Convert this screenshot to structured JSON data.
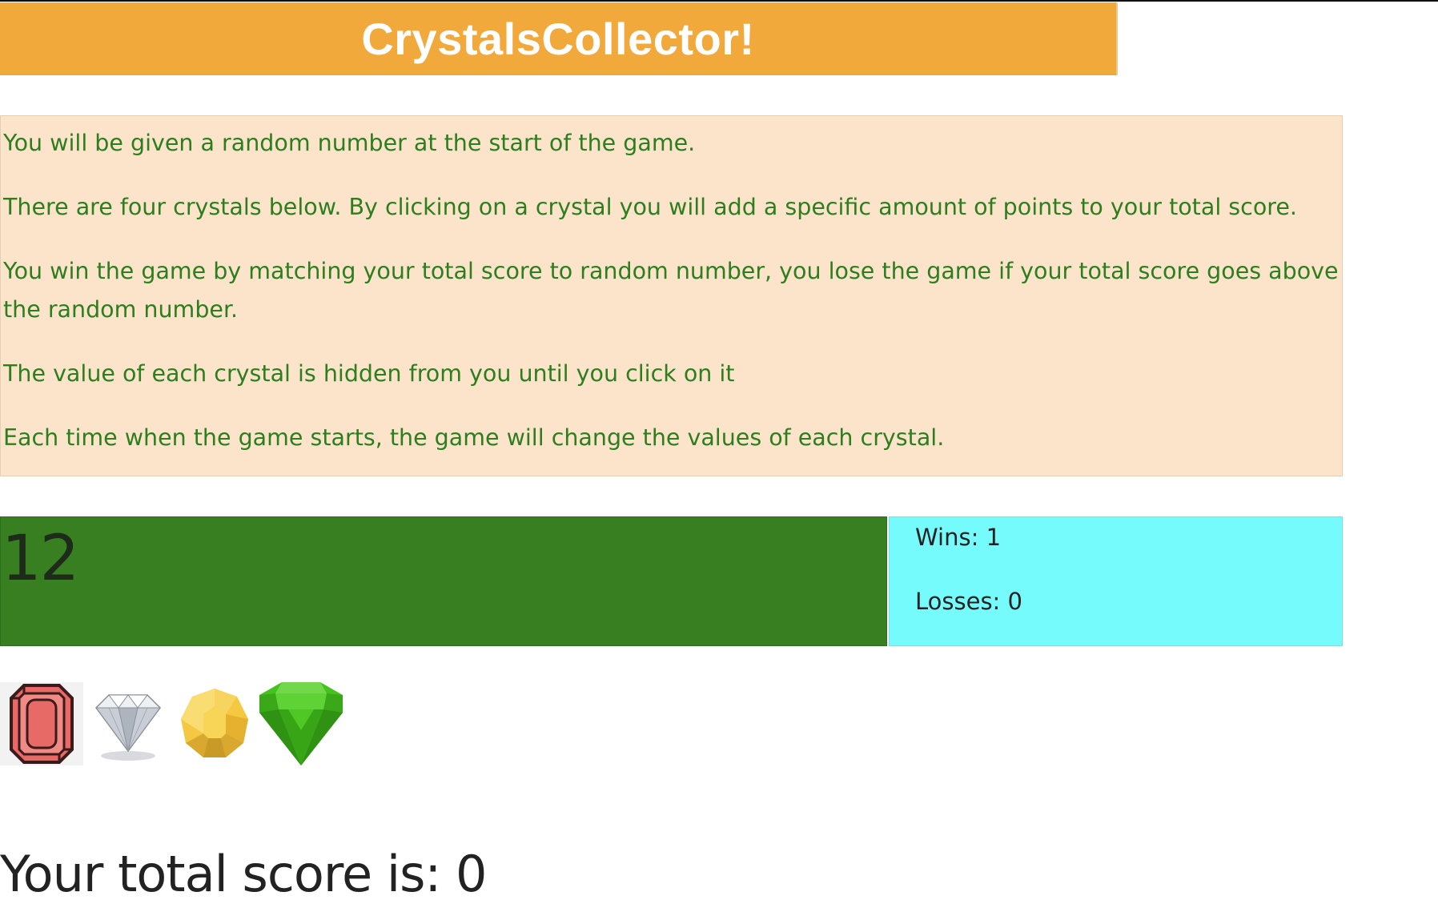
{
  "header": {
    "title": "CrystalsCollector!"
  },
  "instructions": [
    "You will be given a random number at the start of the game.",
    "There are four crystals below. By clicking on a crystal you will add a specific amount of points to your total score.",
    "You win the game by matching your total score to random number, you lose the game if your total score goes above the random number.",
    "The value of each crystal is hidden from you until you click on it",
    "Each time when the game starts, the game will change the values of each crystal."
  ],
  "game": {
    "random_number": "12",
    "wins_text": "Wins: 1",
    "losses_text": "Losses: 0",
    "score_text": "Your total score is: 0"
  },
  "crystals": [
    {
      "icon": "red-crystal-icon",
      "color": "#e86a66"
    },
    {
      "icon": "diamond-crystal-icon",
      "color": "#d9dde2"
    },
    {
      "icon": "yellow-crystal-icon",
      "color": "#f5c842"
    },
    {
      "icon": "green-crystal-icon",
      "color": "#45c21d"
    }
  ],
  "colors": {
    "title_bar": "#f2a93b",
    "instructions_bg": "#fbe4c9",
    "instructions_text": "#2e7d1e",
    "number_box": "#387f22",
    "stats_box": "#76fbfd"
  }
}
